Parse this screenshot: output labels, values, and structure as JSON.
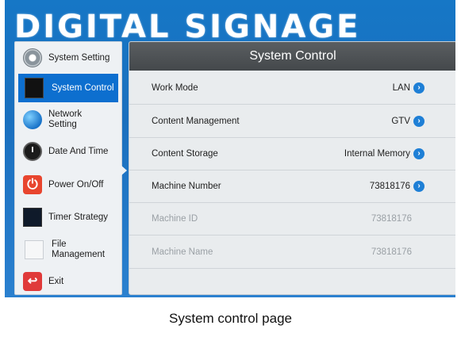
{
  "brand": {
    "title": "DIGITAL SIGNAGE"
  },
  "sidebar": {
    "items": [
      {
        "label": "System Setting",
        "icon": "gear-icon",
        "active": false
      },
      {
        "label": "System Control",
        "icon": "screen-icon",
        "active": true
      },
      {
        "label": "Network Setting",
        "icon": "globe-icon",
        "active": false
      },
      {
        "label": "Date And Time",
        "icon": "clock-icon",
        "active": false
      },
      {
        "label": "Power On/Off",
        "icon": "power-icon",
        "active": false
      },
      {
        "label": "Timer Strategy",
        "icon": "timer-icon",
        "active": false
      },
      {
        "label": "File Management",
        "icon": "file-icon",
        "active": false
      },
      {
        "label": "Exit",
        "icon": "exit-icon",
        "active": false
      }
    ]
  },
  "panel": {
    "title": "System Control",
    "rows": [
      {
        "label": "Work Mode",
        "value": "LAN",
        "editable": true
      },
      {
        "label": "Content Management",
        "value": "GTV",
        "editable": true
      },
      {
        "label": "Content Storage",
        "value": "Internal Memory",
        "editable": true
      },
      {
        "label": "Machine Number",
        "value": "73818176",
        "editable": true
      },
      {
        "label": "Machine ID",
        "value": "73818176",
        "editable": false
      },
      {
        "label": "Machine Name",
        "value": "73818176",
        "editable": false
      }
    ]
  },
  "caption": "System control page",
  "colors": {
    "accent": "#0d6fcf",
    "background": "#1a6fbe",
    "header": "#4a4e51"
  }
}
